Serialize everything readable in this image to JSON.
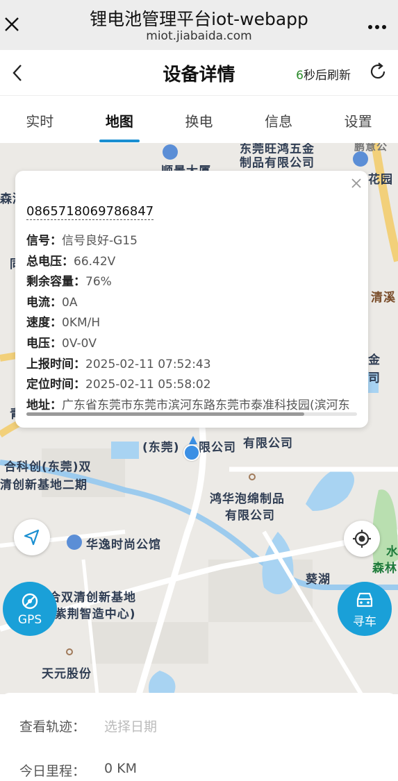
{
  "browser": {
    "title": "锂电池管理平台iot-webapp",
    "url": "miot.jiabaida.com",
    "close_icon": "close-icon",
    "more_icon": "more-icon"
  },
  "header": {
    "title": "设备详情",
    "refresh_count": "6",
    "refresh_suffix": "秒后刷新"
  },
  "tabs": [
    {
      "label": "实时",
      "active": false
    },
    {
      "label": "地图",
      "active": true
    },
    {
      "label": "换电",
      "active": false
    },
    {
      "label": "信息",
      "active": false
    },
    {
      "label": "设置",
      "active": false
    }
  ],
  "popup": {
    "device_id": "0865718069786847",
    "signal_label": "信号：",
    "signal_value": "信号良好-G15",
    "voltage_label": "总电压：",
    "voltage_value": "66.42V",
    "capacity_label": "剩余容量：",
    "capacity_value": "76%",
    "current_label": "电流：",
    "current_value": "0A",
    "speed_label": "速度：",
    "speed_value": "0KM/H",
    "volt_range_label": "电压：",
    "volt_range_value": "0V-0V",
    "report_time_label": "上报时间：",
    "report_time_value": "2025-02-11 07:52:43",
    "locate_time_label": "定位时间：",
    "locate_time_value": "2025-02-11 05:58:02",
    "address_label": "地址：",
    "address_value": "广东省东莞市东莞市滨河东路东莞市泰准科技园(滨河东"
  },
  "map": {
    "labels": {
      "l1": "东莞旺鸿五金",
      "l2": "制品有限公司",
      "l3": "顺景大厦",
      "l4": "鹏意公",
      "l5": "花园",
      "l6": "森湖",
      "l7": "同",
      "l8": "清溪",
      "l9": "金",
      "l10": "司",
      "l11": "青",
      "l12": "(东莞)",
      "l13": "限公司",
      "l14": "有限公司",
      "l15": "合科创(东莞)双",
      "l16": "清创新基地二期",
      "l17": "鸿华泡绵制品",
      "l18": "有限公司",
      "l19": "华逸时尚公馆",
      "l20": "水",
      "l21": "森林",
      "l22": "葵湖",
      "l23": "合双清创新基地",
      "l24": "(紫荆智造中心)",
      "l25": "天元股份"
    },
    "gps_label": "GPS",
    "find_car_label": "寻车"
  },
  "panel": {
    "track_label": "查看轨迹：",
    "track_placeholder": "选择日期",
    "mileage_label": "今日里程：",
    "mileage_value": "0 KM"
  }
}
